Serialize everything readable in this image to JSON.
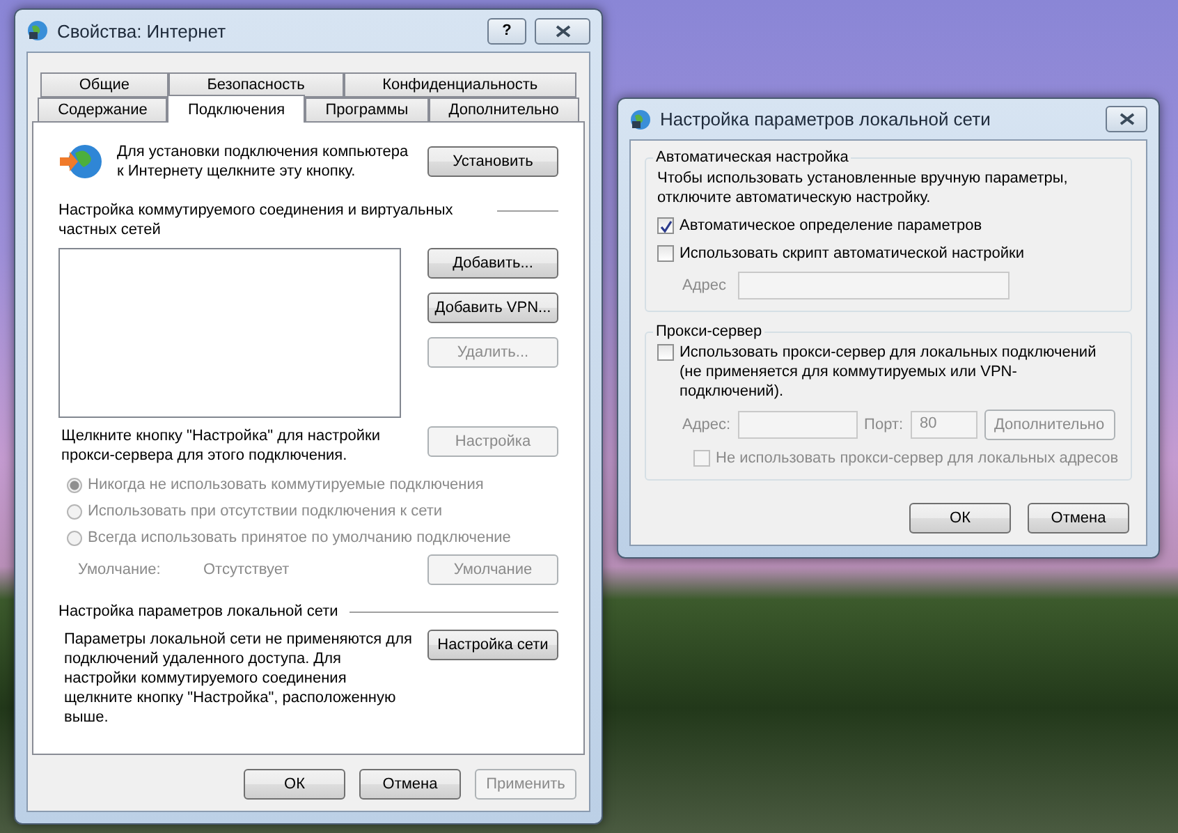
{
  "internet_properties": {
    "title": "Свойства: Интернет",
    "help_button": "?",
    "tab_rows": [
      [
        {
          "label": "Общие",
          "selected": false
        },
        {
          "label": "Безопасность",
          "selected": false
        },
        {
          "label": "Конфиденциальность",
          "selected": false
        }
      ],
      [
        {
          "label": "Содержание",
          "selected": false
        },
        {
          "label": "Подключения",
          "selected": true
        },
        {
          "label": "Программы",
          "selected": false
        },
        {
          "label": "Дополнительно",
          "selected": false
        }
      ]
    ],
    "setup": {
      "text": "Для установки подключения компьютера к Интернету щелкните эту кнопку.",
      "button": "Установить"
    },
    "dialup": {
      "heading": "Настройка коммутируемого соединения и виртуальных частных сетей",
      "buttons": [
        {
          "label": "Добавить...",
          "disabled": false
        },
        {
          "label": "Добавить VPN...",
          "disabled": false
        },
        {
          "label": "Удалить...",
          "disabled": true
        }
      ],
      "proxy_text": "Щелкните кнопку \"Настройка\" для настройки прокси-сервера для этого подключения.",
      "settings_button": {
        "label": "Настройка",
        "disabled": true
      },
      "options": [
        {
          "label": "Никогда не использовать коммутируемые подключения",
          "selected": true,
          "disabled": true
        },
        {
          "label": "Использовать при отсутствии подключения к сети",
          "selected": false,
          "disabled": true
        },
        {
          "label": "Всегда использовать принятое по умолчанию подключение",
          "selected": false,
          "disabled": true
        }
      ],
      "default_label": "Умолчание:",
      "default_value": "Отсутствует",
      "default_button": {
        "label": "Умолчание",
        "disabled": true
      }
    },
    "lan": {
      "heading": "Настройка параметров локальной сети",
      "text": "Параметры локальной сети не применяются для подключений удаленного доступа. Для настройки коммутируемого соединения щелкните кнопку \"Настройка\", расположенную выше.",
      "button": "Настройка сети"
    },
    "buttons": [
      {
        "label": "ОК",
        "disabled": false
      },
      {
        "label": "Отмена",
        "disabled": false
      },
      {
        "label": "Применить",
        "disabled": true
      }
    ]
  },
  "lan_settings": {
    "title": "Настройка параметров локальной сети",
    "auto": {
      "heading": "Автоматическая настройка",
      "text": "Чтобы использовать установленные вручную параметры, отключите автоматическую настройку.",
      "checkboxes": [
        {
          "label": "Автоматическое определение параметров",
          "checked": true,
          "disabled": false
        },
        {
          "label": "Использовать скрипт автоматической настройки",
          "checked": false,
          "disabled": false
        }
      ],
      "address_label": "Адрес"
    },
    "proxy": {
      "heading": "Прокси-сервер",
      "checkbox": {
        "label": "Использовать прокси-сервер для локальных подключений (не применяется для коммутируемых или VPN-подключений).",
        "checked": false
      },
      "address_label": "Адрес:",
      "port_label": "Порт:",
      "port_value": "80",
      "advanced_button": "Дополнительно",
      "bypass": {
        "label": "Не использовать прокси-сервер для локальных адресов",
        "checked": false,
        "disabled": true
      }
    },
    "buttons": [
      {
        "label": "ОК"
      },
      {
        "label": "Отмена"
      }
    ]
  }
}
